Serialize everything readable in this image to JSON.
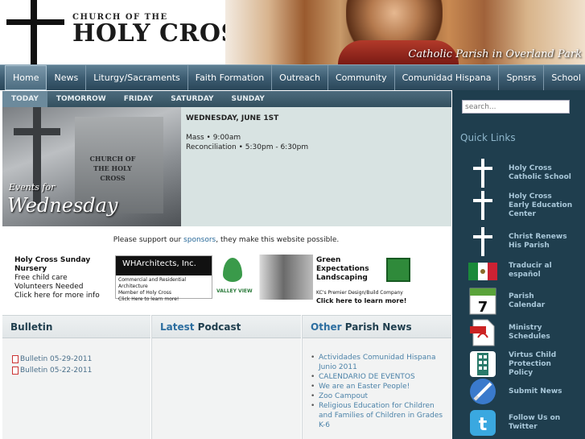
{
  "header": {
    "logo_top": "CHURCH OF THE",
    "logo_main": "HOLY CROSS",
    "tagline": "Catholic Parish in Overland Park"
  },
  "nav": {
    "items": [
      "Home",
      "News",
      "Liturgy/Sacraments",
      "Faith Formation",
      "Outreach",
      "Community",
      "Comunidad Hispana",
      "Spnsrs",
      "School"
    ],
    "active": "Home"
  },
  "day_tabs": [
    "TODAY",
    "TOMORROW",
    "FRIDAY",
    "SATURDAY",
    "SUNDAY"
  ],
  "event": {
    "image_label": "Events for",
    "image_day": "Wednesday",
    "sign_text": "CHURCH OF THE HOLY CROSS",
    "date": "WEDNESDAY, JUNE 1ST",
    "lines": [
      "Mass • 9:00am",
      "Reconciliation • 5:30pm - 6:30pm"
    ]
  },
  "sponsors": {
    "note_prefix": "Please support our",
    "note_link": "sponsors",
    "note_suffix": ", they make this website possible.",
    "ad1": [
      "Holy Cross Sunday Nursery",
      "Free child care",
      "Volunteers Needed",
      "Click here for more info"
    ],
    "ad2_title": "WHArchitects, Inc.",
    "ad2_lines": [
      "Commercial and Residential Architecture",
      "Member of Holy Cross",
      "Click Here to learn more!"
    ],
    "ad3_text": "VALLEY VIEW",
    "ad4_title": "Green Expectations Landscaping",
    "ad4_sub": "KC's Premier Design/Build Company",
    "ad4_cta": "Click here to learn more!"
  },
  "columns": {
    "bulletin": {
      "title": "Bulletin",
      "items": [
        "Bulletin 05-29-2011",
        "Bulletin 05-22-2011"
      ]
    },
    "podcast": {
      "title_hl": "Latest",
      "title_rest": " Podcast"
    },
    "news": {
      "title_hl": "Other",
      "title_rest": " Parish News",
      "items": [
        "Actividades Comunidad Hispana Junio 2011",
        "CALENDARIO DE EVENTOS",
        "We are an Easter People!",
        "Zoo Campout",
        "Religious Education for Children and Families of Children in Grades K-6"
      ]
    }
  },
  "sidebar": {
    "search_placeholder": "search...",
    "quick_links_title": "Quick Links",
    "links": [
      {
        "label": "Holy Cross Catholic School",
        "icon": "cross-icon"
      },
      {
        "label": "Holy Cross Early Education Center",
        "icon": "cross-icon"
      },
      {
        "label": "Christ Renews His Parish",
        "icon": "cross-icon"
      },
      {
        "label": "Traducir al español",
        "icon": "mexico-flag-icon"
      },
      {
        "label": "Parish Calendar",
        "icon": "calendar-icon"
      },
      {
        "label": "Ministry Schedules",
        "icon": "pdf-icon"
      },
      {
        "label": "Virtus Child Protection Policy",
        "icon": "virtus-icon"
      },
      {
        "label": "Submit News",
        "icon": "submit-news-icon"
      },
      {
        "label": "Follow Us on Twitter",
        "icon": "twitter-icon"
      }
    ],
    "calendar_day": "7"
  },
  "colors": {
    "nav_bg": "#3d5d72",
    "sidebar_bg": "#1f3e4e",
    "link": "#4b82a8"
  }
}
